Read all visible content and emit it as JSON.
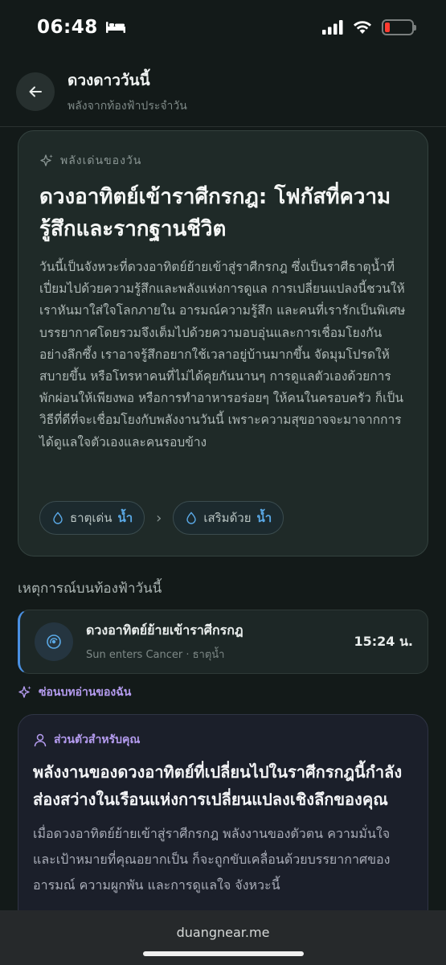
{
  "status": {
    "time": "06:48"
  },
  "header": {
    "title": "ดวงดาววันนี้",
    "subtitle": "พลังจากท้องฟ้าประจำวัน"
  },
  "highlight": {
    "tag": "พลังเด่นของวัน",
    "title": "ดวงอาทิตย์เข้าราศีกรกฎ: โฟกัสที่ความรู้สึกและรากฐานชีวิต",
    "body": "วันนี้เป็นจังหวะที่ดวงอาทิตย์ย้ายเข้าสู่ราศีกรกฎ ซึ่งเป็นราศีธาตุน้ำที่เปี่ยมไปด้วยความรู้สึกและพลังแห่งการดูแล การเปลี่ยนแปลงนี้ชวนให้เราหันมาใส่ใจโลกภายใน อารมณ์ความรู้สึก และคนที่เรารักเป็นพิเศษ บรรยากาศโดยรวมจึงเต็มไปด้วยความอบอุ่นและการเชื่อมโยงกันอย่างลึกซึ้ง เราอาจรู้สึกอยากใช้เวลาอยู่บ้านมากขึ้น จัดมุมโปรดให้สบายขึ้น หรือโทรหาคนที่ไม่ได้คุยกันนานๆ การดูแลตัวเองด้วยการพักผ่อนให้เพียงพอ หรือการทำอาหารอร่อยๆ ให้คนในครอบครัว ก็เป็นวิธีที่ดีที่จะเชื่อมโยงกับพลังงานวันนี้ เพราะความสุขอาจจะมาจากการได้ดูแลใจตัวเองและคนรอบข้าง",
    "pill1_label": "ธาตุเด่น",
    "pill1_value": "น้ำ",
    "pill2_label": "เสริมด้วย",
    "pill2_value": "น้ำ"
  },
  "events_title": "เหตุการณ์บนท้องฟ้าวันนี้",
  "event": {
    "title": "ดวงอาทิตย์ย้ายเข้าราศีกรกฎ",
    "subtitle": "Sun enters Cancer · ธาตุน้ำ",
    "time": "15:24 น."
  },
  "hide_label": "ซ่อนบทอ่านของฉัน",
  "personal": {
    "tag": "ส่วนตัวสำหรับคุณ",
    "title": "พลังงานของดวงอาทิตย์ที่เปลี่ยนไปในราศีกรกฎนี้กำลังส่องสว่างในเรือนแห่งการเปลี่ยนแปลงเชิงลึกของคุณ",
    "body": "เมื่อดวงอาทิตย์ย้ายเข้าสู่ราศีกรกฎ พลังงานของตัวตน ความมั่นใจ และเป้าหมายที่คุณอยากเป็น ก็จะถูกขับเคลื่อนด้วยบรรยากาศของอารมณ์ ความผูกพัน และการดูแลใจ จังหวะนี้"
  },
  "browser": {
    "url": "duangnear.me"
  },
  "colors": {
    "accent_blue": "#4a90e2",
    "accent_purple": "#b59cf0",
    "battery_low": "#ff3b30"
  }
}
